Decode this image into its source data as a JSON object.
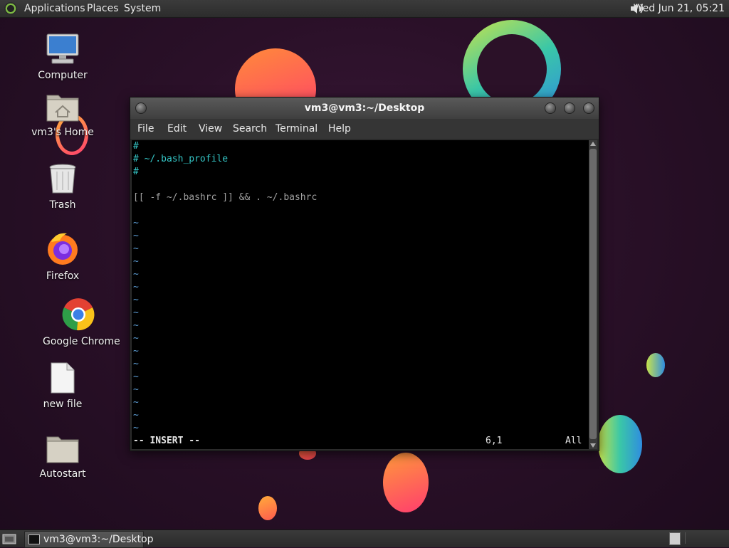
{
  "top_panel": {
    "menus": [
      "Applications",
      "Places",
      "System"
    ],
    "clock": "Wed Jun 21, 05:21"
  },
  "desktop_icons": [
    {
      "label": "Computer",
      "icon": "computer-icon"
    },
    {
      "label": "vm3's Home",
      "icon": "home-folder-icon"
    },
    {
      "label": "Trash",
      "icon": "trash-icon"
    },
    {
      "label": "Firefox",
      "icon": "firefox-icon"
    },
    {
      "label": "Google Chrome",
      "icon": "chrome-icon"
    },
    {
      "label": "new file",
      "icon": "file-icon"
    },
    {
      "label": "Autostart",
      "icon": "folder-icon"
    }
  ],
  "window": {
    "title": "vm3@vm3:~/Desktop",
    "menus": [
      "File",
      "Edit",
      "View",
      "Search",
      "Terminal",
      "Help"
    ],
    "terminal": {
      "lines": [
        "#",
        "# ~/.bash_profile",
        "#",
        "",
        "[[ -f ~/.bashrc ]] && . ~/.bashrc"
      ],
      "tilde": "~",
      "mode": "-- INSERT --",
      "position": "6,1",
      "scroll": "All"
    }
  },
  "taskbar": {
    "items": [
      "vm3@vm3:~/Desktop"
    ]
  },
  "colors": {
    "vim_comment": "#34c6c6",
    "vim_tilde": "#5e9fd6",
    "desktop_bg": "#2a1028"
  }
}
